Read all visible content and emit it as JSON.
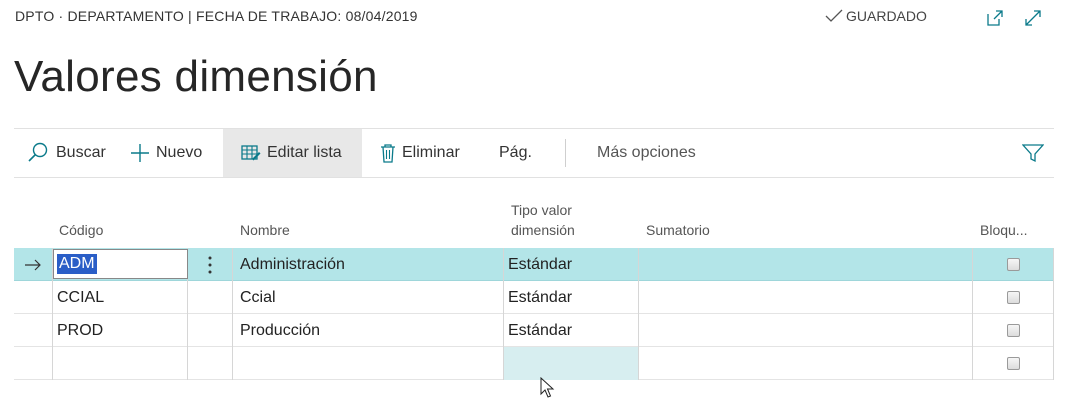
{
  "header": {
    "caption": "DPTO · DEPARTAMENTO | FECHA DE TRABAJO: 08/04/2019",
    "status": "GUARDADO",
    "title": "Valores dimensión"
  },
  "actions": {
    "search": "Buscar",
    "new": "Nuevo",
    "edit_list": "Editar lista",
    "delete": "Eliminar",
    "page": "Pág.",
    "more": "Más opciones"
  },
  "columns": {
    "code": "Código",
    "name": "Nombre",
    "type": "Tipo valor\ndimensión",
    "sum": "Sumatorio",
    "blocked": "Bloqu..."
  },
  "rows": [
    {
      "code": "ADM",
      "name": "Administración",
      "type": "Estándar",
      "sum": "",
      "blocked": false
    },
    {
      "code": "CCIAL",
      "name": "Ccial",
      "type": "Estándar",
      "sum": "",
      "blocked": false
    },
    {
      "code": "PROD",
      "name": "Producción",
      "type": "Estándar",
      "sum": "",
      "blocked": false
    },
    {
      "code": "",
      "name": "",
      "type": "",
      "sum": "",
      "blocked": false
    }
  ],
  "colors": {
    "selected_row": "#b3e5e8",
    "text_selection": "#2a5ec7",
    "accent": "#0a7a8a"
  },
  "icons": [
    "check-icon",
    "open-new-window-icon",
    "expand-icon",
    "search-icon",
    "plus-icon",
    "edit-list-icon",
    "trash-icon",
    "filter-icon",
    "row-arrow-icon",
    "more-dots-icon",
    "mouse-cursor-icon"
  ]
}
